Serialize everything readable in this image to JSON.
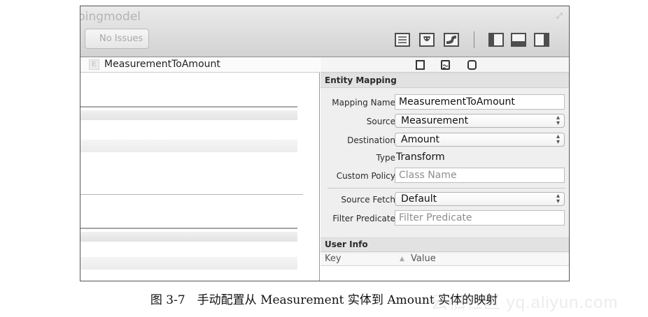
{
  "window": {
    "title": "pingmodel",
    "issues_label": "No Issues"
  },
  "left_pane": {
    "entity_badge": "E",
    "entity_title": "MeasurementToAmount"
  },
  "inspector": {
    "tabs": [
      "file-inspector-icon",
      "quick-help-icon",
      "data-model-inspector-icon"
    ],
    "entity_mapping": {
      "section_title": "Entity Mapping",
      "mapping_name_label": "Mapping Name",
      "mapping_name_value": "MeasurementToAmount",
      "source_label": "Source",
      "source_value": "Measurement",
      "destination_label": "Destination",
      "destination_value": "Amount",
      "type_label": "Type",
      "type_value": "Transform",
      "custom_policy_label": "Custom Policy",
      "custom_policy_placeholder": "Class Name",
      "source_fetch_label": "Source Fetch",
      "source_fetch_value": "Default",
      "filter_predicate_label": "Filter Predicate",
      "filter_predicate_placeholder": "Filter Predicate"
    },
    "user_info": {
      "section_title": "User Info",
      "columns": [
        "Key",
        "Value"
      ]
    }
  },
  "caption": "图 3-7　手动配置从 Measurement 实体到 Amount 实体的映射",
  "watermark": "云栖社区 yq.aliyun.com"
}
